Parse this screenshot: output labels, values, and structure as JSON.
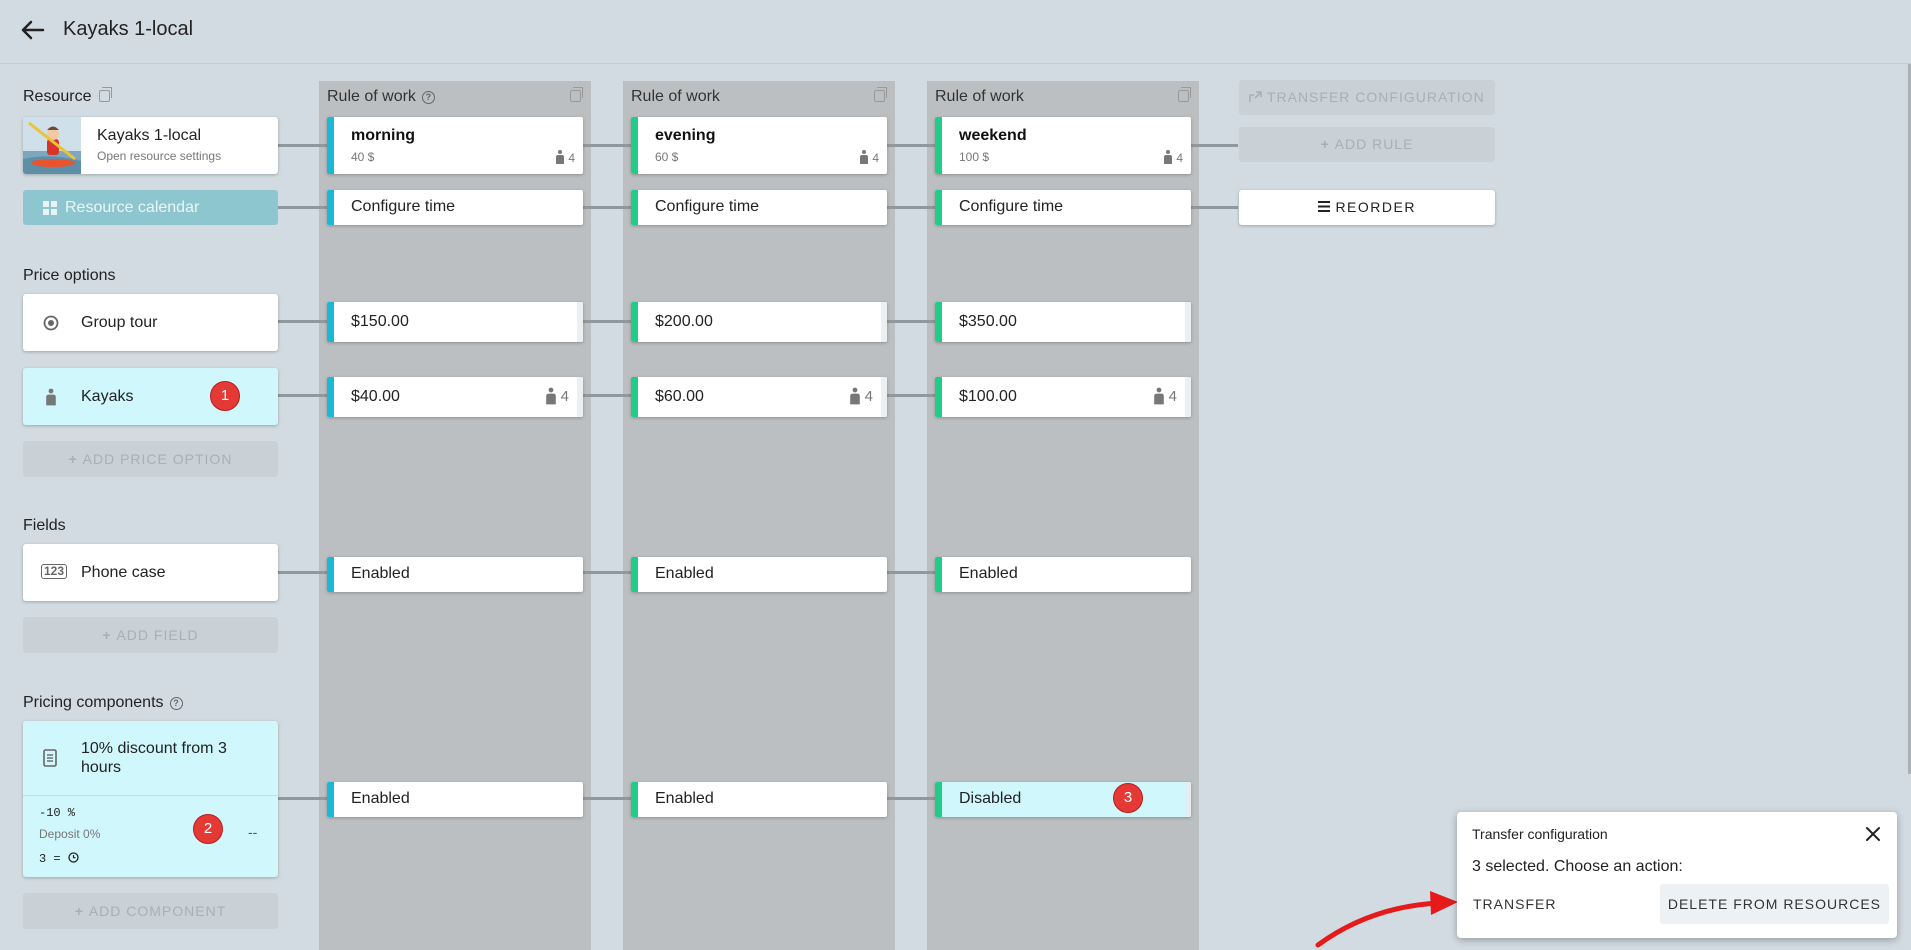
{
  "header": {
    "title": "Kayaks 1-local"
  },
  "sections": {
    "resource": "Resource",
    "price_options": "Price options",
    "fields": "Fields",
    "pricing_components": "Pricing components"
  },
  "resource": {
    "name": "Kayaks 1-local",
    "subtitle": "Open resource settings",
    "calendar_button": "Resource calendar"
  },
  "price_options": [
    {
      "label": "Group tour",
      "icon": "radio-target-icon"
    },
    {
      "label": "Kayaks",
      "icon": "person-icon",
      "badge": "1"
    }
  ],
  "add_price_option": "ADD PRICE OPTION",
  "fields": [
    {
      "label": "Phone case",
      "icon": "numbers-icon"
    }
  ],
  "add_field": "ADD FIELD",
  "pricing_component": {
    "title": "10% discount from 3 hours",
    "discount": "-10 %",
    "deposit": "Deposit 0%",
    "rule": "3 =",
    "dash": "--",
    "badge": "2"
  },
  "add_component": "ADD COMPONENT",
  "rules": [
    {
      "header": "Rule of work",
      "name": "morning",
      "price": "40 $",
      "capacity": "4",
      "stripe": "#1ab8d6",
      "configure": "Configure time",
      "group_price": "$150.00",
      "kayak_price": "$40.00",
      "kayak_capacity": "4",
      "field_state": "Enabled",
      "component_state": "Enabled"
    },
    {
      "header": "Rule of work",
      "name": "evening",
      "price": "60 $",
      "capacity": "4",
      "stripe": "#22cc88",
      "configure": "Configure time",
      "group_price": "$200.00",
      "kayak_price": "$60.00",
      "kayak_capacity": "4",
      "field_state": "Enabled",
      "component_state": "Enabled"
    },
    {
      "header": "Rule of work",
      "name": "weekend",
      "price": "100 $",
      "capacity": "4",
      "stripe": "#22cc88",
      "configure": "Configure time",
      "group_price": "$350.00",
      "kayak_price": "$100.00",
      "kayak_capacity": "4",
      "field_state": "Enabled",
      "component_state": "Disabled",
      "component_badge": "3"
    }
  ],
  "actions": {
    "transfer_configuration": "TRANSFER CONFIGURATION",
    "add_rule": "ADD RULE",
    "reorder": "REORDER"
  },
  "popup": {
    "title": "Transfer configuration",
    "message": "3 selected. Choose an action:",
    "transfer": "TRANSFER",
    "delete": "DELETE FROM RESOURCES"
  },
  "colors": {
    "accent_cyan": "#1ab8d6",
    "accent_green": "#22cc88",
    "badge_red": "#e53935",
    "selected_bg": "#cff7fc"
  }
}
